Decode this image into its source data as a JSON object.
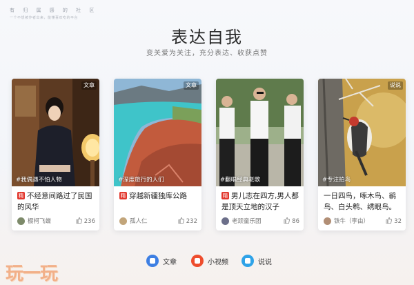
{
  "brand": {
    "name": "有 归 属 感 的 社 区",
    "slogan": "一个不想被作者出来，能懂喜欢吃的平台"
  },
  "hero": {
    "title": "表达自我",
    "subtitle": "变关爱为关注，充分表达、收获点赞"
  },
  "cards": [
    {
      "type_tag": "文章",
      "hashtag": "#我偶遇不怕人物",
      "badge": "精",
      "title": "不经意间路过了民国的风华",
      "author": "橱柯飞蝶",
      "likes": "236"
    },
    {
      "type_tag": "文章",
      "hashtag": "#深度旅行的人们",
      "badge": "精",
      "title": "穿越新疆独库公路",
      "author": "孤人仁",
      "likes": "232"
    },
    {
      "type_tag": "",
      "hashtag": "#翻唱经典老歌",
      "badge": "精",
      "title": "男儿志在四方,男人都是顶天立地的汉子",
      "author": "老顽童乐团",
      "likes": "86"
    },
    {
      "type_tag": "说说",
      "hashtag": "#专注拍鸟",
      "badge": "",
      "title": "一日四鸟，啄木鸟、鹟鸟、白头鹎、绣眼鸟。",
      "author": "铁牛（李由）",
      "likes": "32"
    }
  ],
  "nav": {
    "article": "文章",
    "video": "小视频",
    "talk": "说说"
  },
  "watermark": "玩一玩",
  "colors": {
    "badge_red": "#e2372d",
    "article_blue": "#3d7fe3",
    "video_red": "#ee4d2d",
    "talk_blue": "#2fa3e8"
  }
}
